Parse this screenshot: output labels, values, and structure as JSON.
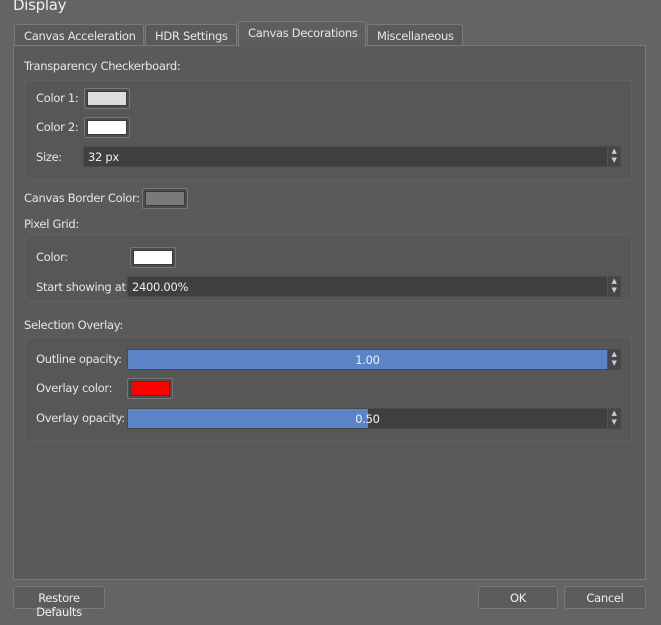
{
  "window": {
    "title": "Display"
  },
  "tabs": [
    {
      "label": "Canvas Acceleration"
    },
    {
      "label": "HDR Settings"
    },
    {
      "label": "Canvas Decorations"
    },
    {
      "label": "Miscellaneous"
    }
  ],
  "checkerboard": {
    "heading": "Transparency Checkerboard:",
    "color1_label": "Color 1:",
    "color1": "#dcdcdc",
    "color2_label": "Color 2:",
    "color2": "#ffffff",
    "size_label": "Size:",
    "size_value": "32 px"
  },
  "canvas_border": {
    "label": "Canvas Border Color:",
    "color": "#7a7a7a"
  },
  "pixel_grid": {
    "heading": "Pixel Grid:",
    "color_label": "Color:",
    "color": "#ffffff",
    "start_label": "Start showing at:",
    "start_value": "2400.00%"
  },
  "selection_overlay": {
    "heading": "Selection Overlay:",
    "outline_label": "Outline opacity:",
    "outline_value": "1.00",
    "outline_fraction": 1.0,
    "overlay_color_label": "Overlay color:",
    "overlay_color": "#ff0000",
    "overlay_opacity_label": "Overlay opacity:",
    "overlay_opacity_value": "0.50",
    "overlay_opacity_fraction": 0.5
  },
  "buttons": {
    "restore": "Restore Defaults",
    "ok": "OK",
    "cancel": "Cancel"
  }
}
